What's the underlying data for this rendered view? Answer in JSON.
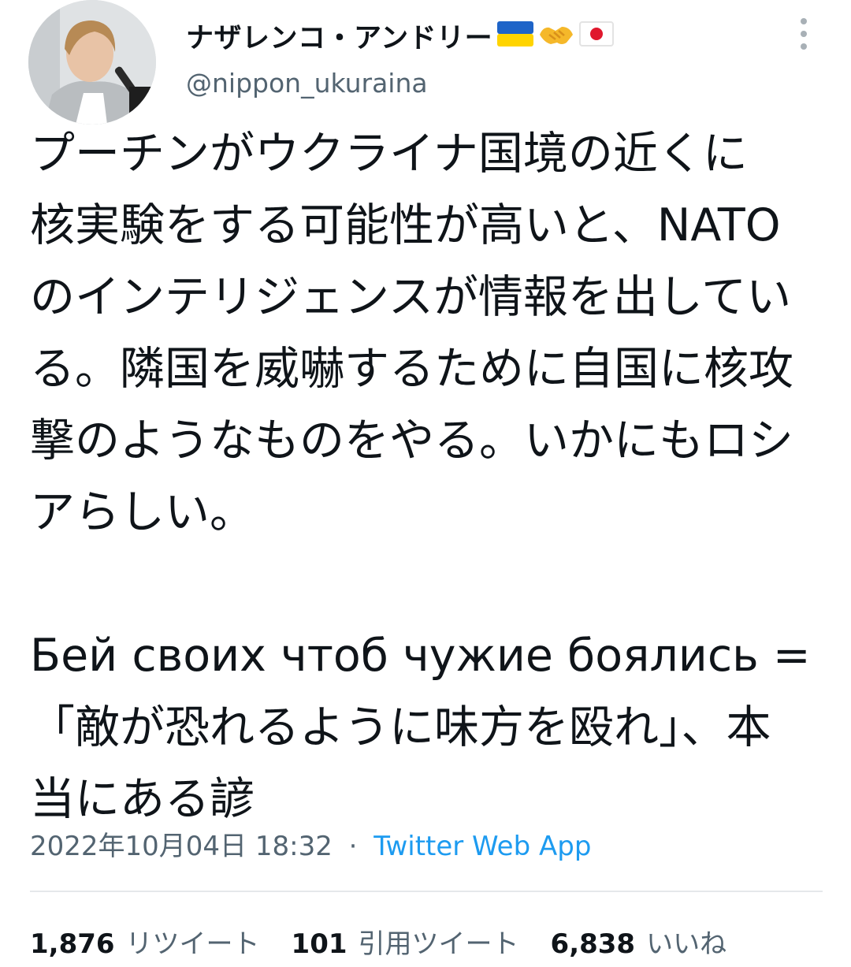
{
  "author": {
    "display_name": "ナザレンコ・アンドリー",
    "handle": "@nippon_ukuraina",
    "emojis": [
      "ukraine-flag",
      "handshake",
      "japan-flag"
    ]
  },
  "tweet": {
    "lines": [
      "プーチンがウクライナ国境の近くに",
      "核実験をする可能性が高いと、NATO",
      "のインテリジェンスが情報を出してい",
      "る。隣国を威嚇するために自国に核攻",
      "撃のようなものをやる。いかにもロシ",
      "アらしい。",
      "",
      "Бей своих чтоб чужие боялись =",
      "「敵が恐れるように味方を殴れ」、本",
      "当にある諺"
    ]
  },
  "meta": {
    "datetime": "2022年10月04日 18:32",
    "separator": "·",
    "source": "Twitter Web App"
  },
  "stats": {
    "retweets": {
      "count": "1,876",
      "label": "リツイート"
    },
    "quotes": {
      "count": "101",
      "label": "引用ツイート"
    },
    "likes": {
      "count": "6,838",
      "label": "いいね"
    }
  },
  "colors": {
    "text": "#0f1419",
    "muted": "#536471",
    "link": "#1d9bf0",
    "divider": "#e5e8eb"
  }
}
